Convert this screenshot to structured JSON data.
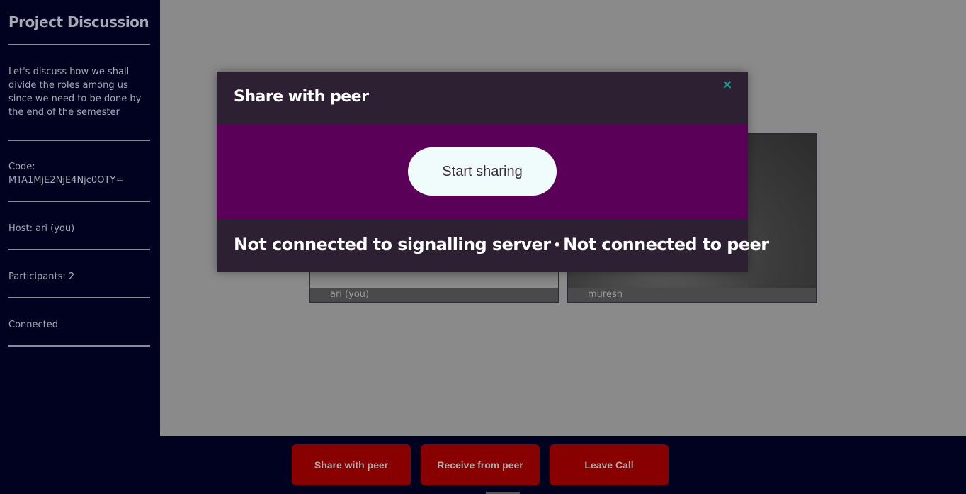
{
  "sidebar": {
    "title": "Project Discussion",
    "description": "Let's discuss how we shall divide the roles among us since we need to be done by the end of the semester",
    "code_label": "Code:",
    "code_value": "MTA1MjE2NjE4Njc0OTY=",
    "host": "Host: ari (you)",
    "participants": "Participants: 2",
    "status": "Connected"
  },
  "tiles": [
    {
      "name": "ari (you)"
    },
    {
      "name": "muresh"
    }
  ],
  "modal": {
    "title": "Share with peer",
    "close_icon": "×",
    "start_button": "Start sharing",
    "status_signalling": "Not connected to signalling server",
    "separator": "•",
    "status_peer": "Not connected to peer"
  },
  "bottom_bar": {
    "share_button": "Share with peer",
    "receive_button": "Receive from peer",
    "leave_button": "Leave Call"
  },
  "colors": {
    "sidebar_bg": "#010120",
    "modal_header_bg": "#2d2032",
    "modal_body_bg": "#5a0059",
    "button_red": "#880000",
    "close_accent": "#1ea39a"
  }
}
